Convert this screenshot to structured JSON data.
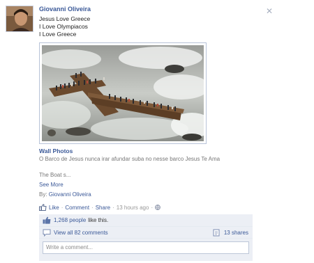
{
  "post": {
    "author": "Giovanni Oliveira",
    "message_lines": [
      "Jesus Love Greece",
      "I Love Olympiacos",
      "I Love Greece"
    ],
    "album_title": "Wall Photos",
    "album_desc": "O Barco de Jesus nunca irar afundar suba no nesse barco Jesus Te Ama",
    "preview": "The Boat s...",
    "see_more": "See More",
    "by_label": "By:",
    "by_name": "Giovanni Oliveira"
  },
  "actions": {
    "like": "Like",
    "comment": "Comment",
    "share": "Share",
    "time": "13 hours ago"
  },
  "feedback": {
    "likes_count": "1,268 people",
    "likes_suffix": "like this.",
    "view_comments": "View all 82 comments",
    "shares": "13 shares",
    "comment_placeholder": "Write a comment..."
  },
  "icons": {
    "close": "close-icon",
    "like": "thumbs-up-icon",
    "comment": "speech-bubble-icon",
    "share": "share-icon",
    "privacy": "globe-icon"
  },
  "colors": {
    "link": "#3b5998",
    "feedback_bg": "#eceff5",
    "muted": "#777777"
  }
}
